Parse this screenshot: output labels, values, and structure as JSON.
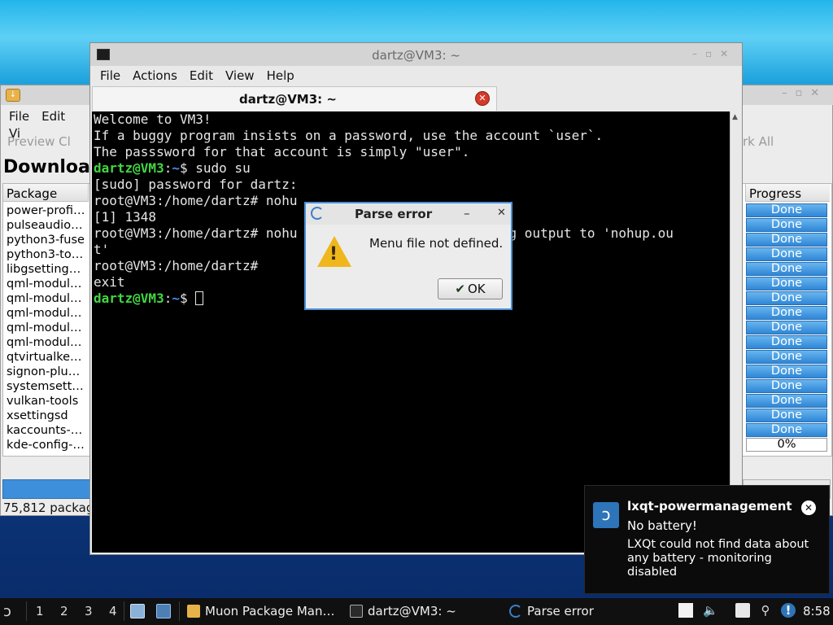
{
  "muon": {
    "menu": [
      "File",
      "Edit",
      "Vi"
    ],
    "toolbar": {
      "preview": "Preview Cl",
      "mark_all": "rk All"
    },
    "heading": "Downloa",
    "columns": {
      "package": "Package",
      "progress": "Progress"
    },
    "packages": [
      "power-profi…",
      "pulseaudio…",
      "python3-fuse",
      "python3-to…",
      "libgsetting…",
      "qml-modul…",
      "qml-modul…",
      "qml-modul…",
      "qml-modul…",
      "qml-modul…",
      "qtvirtualke…",
      "signon-plu…",
      "systemsett…",
      "vulkan-tools",
      "xsettingsd",
      "kaccounts-…",
      "kde-config-…"
    ],
    "progress": [
      "Done",
      "Done",
      "Done",
      "Done",
      "Done",
      "Done",
      "Done",
      "Done",
      "Done",
      "Done",
      "Done",
      "Done",
      "Done",
      "Done",
      "Done",
      "Done",
      "0%"
    ],
    "status": "75,812 packag"
  },
  "terminal": {
    "window_title": "dartz@VM3: ~",
    "menu": [
      "File",
      "Actions",
      "Edit",
      "View",
      "Help"
    ],
    "tab_label": "dartz@VM3: ~",
    "lines": [
      "Welcome to VM3!",
      "If a buggy program insists on a password, use the account `user`.",
      "The passsword for that account is simply \"user\".",
      "",
      "[sudo] password for dartz:",
      "root@VM3:/home/dartz# nohu",
      "[1] 1348",
      "root@VM3:/home/dartz# nohu                      ending output to 'nohup.ou",
      "t'",
      "root@VM3:/home/dartz#",
      "exit"
    ],
    "prompt_user": "dartz@VM3",
    "prompt_path": "~",
    "prompt_symbol": "$",
    "command": "sudo su"
  },
  "dialog": {
    "title": "Parse error",
    "message": "Menu file not defined.",
    "ok_label": "OK",
    "min_glyph": "–",
    "close_glyph": "✕"
  },
  "notification": {
    "app": "lxqt-powermanagement",
    "summary": "No battery!",
    "body": "LXQt could not find data about any battery - monitoring disabled"
  },
  "taskbar": {
    "workspaces": [
      "1",
      "2",
      "3",
      "4"
    ],
    "tasks": [
      "Muon Package Man…",
      "dartz@VM3: ~",
      "Parse error"
    ],
    "clock": "8:58"
  }
}
